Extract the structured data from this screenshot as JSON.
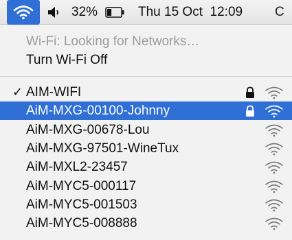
{
  "menubar": {
    "battery_percent": "32%",
    "clock": "Thu 15 Oct  12:09",
    "cut_item": "C",
    "wifi_icon": "wifi-icon",
    "speaker_icon": "speaker-icon",
    "battery_icon": "battery-icon",
    "battery_level": 0.32,
    "accent_color": "#2f6fd6"
  },
  "menu": {
    "status_text": "Wi-Fi: Looking for Networks…",
    "toggle_label": "Turn Wi-Fi Off",
    "checkmark": "✓",
    "networks": [
      {
        "name": "AIM-WIFI",
        "secured": true,
        "connected": true,
        "selected": false
      },
      {
        "name": "AiM-MXG-00100-Johnny",
        "secured": true,
        "connected": false,
        "selected": true
      },
      {
        "name": "AiM-MXG-00678-Lou",
        "secured": false,
        "connected": false,
        "selected": false
      },
      {
        "name": "AiM-MXG-97501-WineTux",
        "secured": false,
        "connected": false,
        "selected": false
      },
      {
        "name": "AiM-MXL2-23457",
        "secured": false,
        "connected": false,
        "selected": false
      },
      {
        "name": "AiM-MYC5-000117",
        "secured": false,
        "connected": false,
        "selected": false
      },
      {
        "name": "AiM-MYC5-001503",
        "secured": false,
        "connected": false,
        "selected": false
      },
      {
        "name": "AiM-MYC5-008888",
        "secured": false,
        "connected": false,
        "selected": false
      }
    ]
  }
}
